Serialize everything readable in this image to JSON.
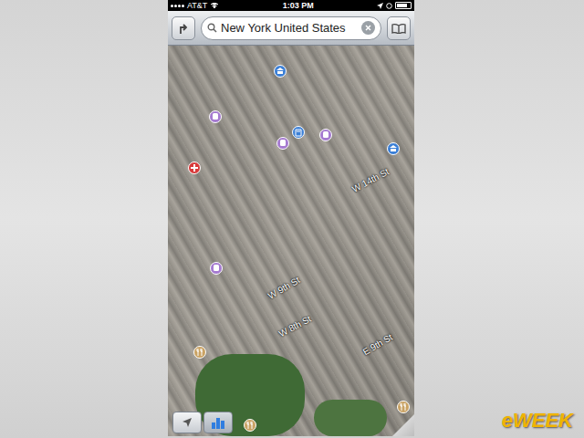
{
  "status_bar": {
    "carrier": "AT&T",
    "time": "1:03 PM",
    "battery_level": 0.8
  },
  "toolbar": {
    "search_text": "New York United States"
  },
  "map": {
    "street_labels": [
      "W 14th St",
      "W 9th St",
      "W 8th St",
      "E 9th St"
    ],
    "pins": [
      {
        "kind": "museum",
        "color": "#3b7fd6"
      },
      {
        "kind": "train",
        "color": "#a57ad0"
      },
      {
        "kind": "info",
        "color": "#3b7fd6"
      },
      {
        "kind": "train",
        "color": "#a57ad0"
      },
      {
        "kind": "train",
        "color": "#a57ad0"
      },
      {
        "kind": "museum",
        "color": "#3b7fd6"
      },
      {
        "kind": "hospital",
        "color": "#d83a3a"
      },
      {
        "kind": "train",
        "color": "#a57ad0"
      },
      {
        "kind": "food",
        "color": "#c9a263"
      },
      {
        "kind": "food",
        "color": "#c9a263"
      },
      {
        "kind": "food",
        "color": "#c9a263"
      }
    ]
  },
  "controls": [
    {
      "kind": "location",
      "selected": false
    },
    {
      "kind": "buildings",
      "selected": true
    }
  ],
  "watermark": "eWEEK"
}
